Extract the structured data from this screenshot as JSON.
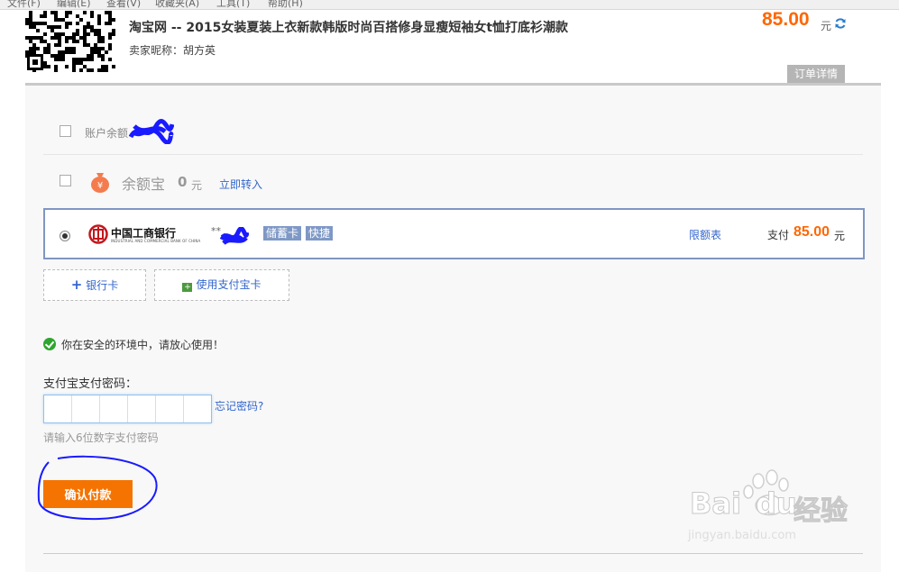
{
  "menu": [
    "文件(F)",
    "编辑(E)",
    "查看(V)",
    "收藏夹(A)",
    "工具(T)",
    "帮助(H)"
  ],
  "order": {
    "title": "淘宝网 -- 2015女装夏装上衣新款韩版时尚百搭修身显瘦短袖女t恤打底衫潮款",
    "seller": "卖家昵称：胡方英",
    "price": "85.00",
    "price_unit": "元",
    "detail_button": "订单详情"
  },
  "payment_options": {
    "balance_label": "账户余额",
    "yuebao": {
      "label": "余额宝",
      "amount": "0",
      "unit": "元",
      "transfer_link": "立即转入"
    },
    "bank": {
      "name": "中国工商银行",
      "subname": "INDUSTRIAL AND COMMERCIAL BANK OF CHINA",
      "card_mask": "**",
      "tags": [
        "储蓄卡",
        "快捷"
      ],
      "limit_link": "限额表",
      "pay_label": "支付",
      "pay_amount": "85.00",
      "pay_unit": "元"
    }
  },
  "add_buttons": {
    "bank_card": "银行卡",
    "alipay_card": "使用支付宝卡"
  },
  "security": {
    "safe_text": "你在安全的环境中，请放心使用！"
  },
  "password": {
    "label": "支付宝支付密码：",
    "forgot_link": "忘记密码?",
    "hint": "请输入6位数字支付密码",
    "cells": 6
  },
  "confirm_button": "确认付款",
  "watermark": {
    "text1": "Bai",
    "text2": "du",
    "text3": "经验",
    "url": "jingyan.baidu.com"
  },
  "colors": {
    "accent": "#f57300",
    "price": "#ff6600",
    "link": "#3366cc",
    "tag": "#7e98c6",
    "safe": "#2fa52f"
  }
}
